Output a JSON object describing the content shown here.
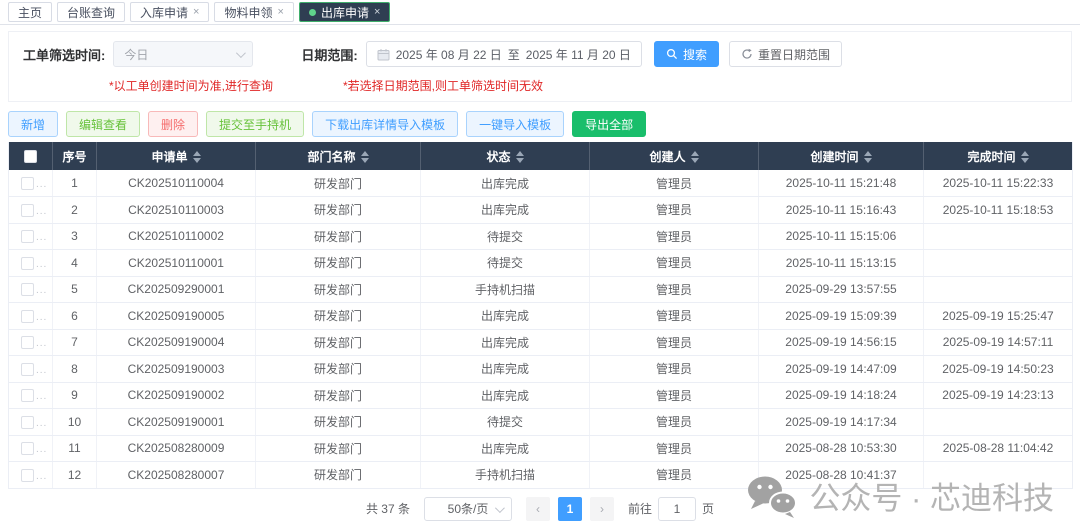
{
  "tabs": [
    {
      "label": "主页",
      "active": false,
      "closable": false
    },
    {
      "label": "台账查询",
      "active": false,
      "closable": false
    },
    {
      "label": "入库申请",
      "active": false,
      "closable": true
    },
    {
      "label": "物料申领",
      "active": false,
      "closable": true
    },
    {
      "label": "出库申请",
      "active": true,
      "closable": true
    }
  ],
  "icons": {
    "close_x": "×",
    "prev_arrow": "‹",
    "next_arrow": "›"
  },
  "filters": {
    "time_filter_label": "工单筛选时间:",
    "time_filter_value": "今日",
    "time_filter_hint": "*以工单创建时间为准,进行查询",
    "date_range_label": "日期范围:",
    "date_start": "2025 年 08 月 22 日",
    "date_separator": "至",
    "date_end": "2025 年 11 月 20 日",
    "date_range_hint": "*若选择日期范围,则工单筛选时间无效",
    "search_button": "搜索",
    "reset_button": "重置日期范围"
  },
  "toolbar": {
    "buttons": [
      {
        "label": "新增",
        "variant": "blue-light",
        "name": "add-button"
      },
      {
        "label": "编辑查看",
        "variant": "green-light",
        "name": "edit-view-button"
      },
      {
        "label": "删除",
        "variant": "red-light",
        "name": "delete-button"
      },
      {
        "label": "提交至手持机",
        "variant": "green-light",
        "name": "submit-to-handheld-button"
      },
      {
        "label": "下载出库详情导入模板",
        "variant": "blue-light",
        "name": "download-outbound-template-button"
      },
      {
        "label": "一键导入模板",
        "variant": "blue-light",
        "name": "one-click-import-template-button"
      },
      {
        "label": "导出全部",
        "variant": "green-solid",
        "name": "export-all-button"
      }
    ]
  },
  "table": {
    "ellipsis": "...",
    "columns": [
      {
        "label": "序号",
        "sortable": false
      },
      {
        "label": "申请单",
        "sortable": true
      },
      {
        "label": "部门名称",
        "sortable": true
      },
      {
        "label": "状态",
        "sortable": true
      },
      {
        "label": "创建人",
        "sortable": true
      },
      {
        "label": "创建时间",
        "sortable": true
      },
      {
        "label": "完成时间",
        "sortable": true
      }
    ],
    "rows": [
      {
        "index": "1",
        "order_no": "CK202510110004",
        "department": "研发部门",
        "status": "出库完成",
        "creator": "管理员",
        "created_at": "2025-10-11 15:21:48",
        "completed_at": "2025-10-11 15:22:33"
      },
      {
        "index": "2",
        "order_no": "CK202510110003",
        "department": "研发部门",
        "status": "出库完成",
        "creator": "管理员",
        "created_at": "2025-10-11 15:16:43",
        "completed_at": "2025-10-11 15:18:53"
      },
      {
        "index": "3",
        "order_no": "CK202510110002",
        "department": "研发部门",
        "status": "待提交",
        "creator": "管理员",
        "created_at": "2025-10-11 15:15:06",
        "completed_at": ""
      },
      {
        "index": "4",
        "order_no": "CK202510110001",
        "department": "研发部门",
        "status": "待提交",
        "creator": "管理员",
        "created_at": "2025-10-11 15:13:15",
        "completed_at": ""
      },
      {
        "index": "5",
        "order_no": "CK202509290001",
        "department": "研发部门",
        "status": "手持机扫描",
        "creator": "管理员",
        "created_at": "2025-09-29 13:57:55",
        "completed_at": ""
      },
      {
        "index": "6",
        "order_no": "CK202509190005",
        "department": "研发部门",
        "status": "出库完成",
        "creator": "管理员",
        "created_at": "2025-09-19 15:09:39",
        "completed_at": "2025-09-19 15:25:47"
      },
      {
        "index": "7",
        "order_no": "CK202509190004",
        "department": "研发部门",
        "status": "出库完成",
        "creator": "管理员",
        "created_at": "2025-09-19 14:56:15",
        "completed_at": "2025-09-19 14:57:11"
      },
      {
        "index": "8",
        "order_no": "CK202509190003",
        "department": "研发部门",
        "status": "出库完成",
        "creator": "管理员",
        "created_at": "2025-09-19 14:47:09",
        "completed_at": "2025-09-19 14:50:23"
      },
      {
        "index": "9",
        "order_no": "CK202509190002",
        "department": "研发部门",
        "status": "出库完成",
        "creator": "管理员",
        "created_at": "2025-09-19 14:18:24",
        "completed_at": "2025-09-19 14:23:13"
      },
      {
        "index": "10",
        "order_no": "CK202509190001",
        "department": "研发部门",
        "status": "待提交",
        "creator": "管理员",
        "created_at": "2025-09-19 14:17:34",
        "completed_at": ""
      },
      {
        "index": "11",
        "order_no": "CK202508280009",
        "department": "研发部门",
        "status": "出库完成",
        "creator": "管理员",
        "created_at": "2025-08-28 10:53:30",
        "completed_at": "2025-08-28 11:04:42"
      },
      {
        "index": "12",
        "order_no": "CK202508280007",
        "department": "研发部门",
        "status": "手持机扫描",
        "creator": "管理员",
        "created_at": "2025-08-28 10:41:37",
        "completed_at": ""
      }
    ]
  },
  "pagination": {
    "total_label": "共 37 条",
    "page_size": "50条/页",
    "current_page": "1",
    "goto_label": "前往",
    "goto_value": "1",
    "goto_unit": "页"
  },
  "watermark": {
    "text": "公众号 · 芯迪科技"
  },
  "colors": {
    "header_bg": "#2f3e52",
    "primary_blue": "#409eff",
    "success_green": "#19be6b",
    "tab_active_border": "#3fae6c",
    "hint_red": "#e02626"
  }
}
